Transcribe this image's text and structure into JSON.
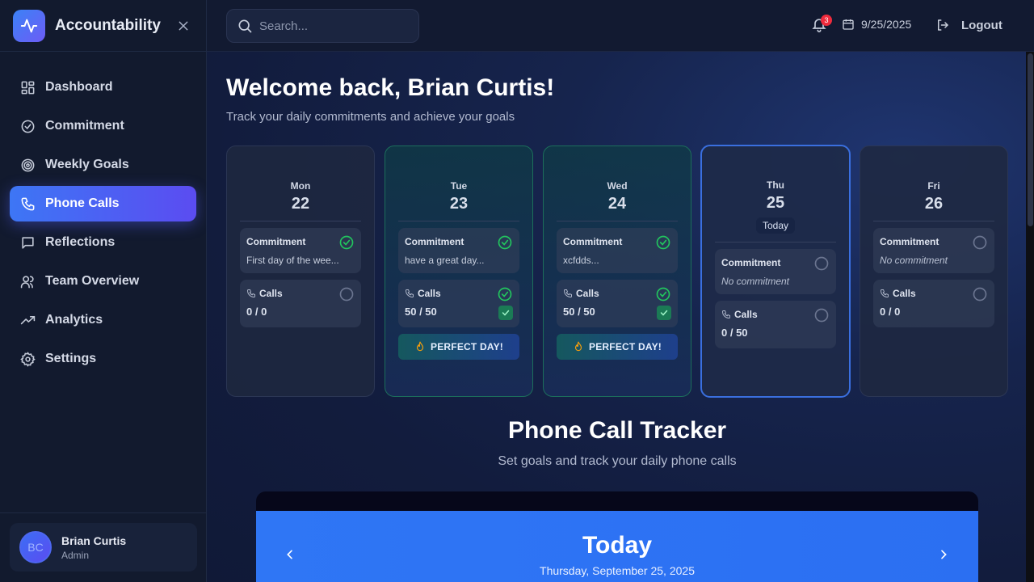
{
  "app": {
    "title": "Accountability"
  },
  "sidebar": {
    "items": [
      {
        "label": "Dashboard",
        "icon": "dashboard-icon"
      },
      {
        "label": "Commitment",
        "icon": "check-circle-icon"
      },
      {
        "label": "Weekly Goals",
        "icon": "target-icon"
      },
      {
        "label": "Phone Calls",
        "icon": "phone-icon",
        "active": true
      },
      {
        "label": "Reflections",
        "icon": "message-square-icon"
      },
      {
        "label": "Team Overview",
        "icon": "users-icon"
      },
      {
        "label": "Analytics",
        "icon": "trending-up-icon"
      },
      {
        "label": "Settings",
        "icon": "gear-icon"
      }
    ],
    "user": {
      "initials": "BC",
      "name": "Brian Curtis",
      "role": "Admin"
    }
  },
  "header": {
    "search_placeholder": "Search...",
    "notifications_count": "3",
    "date": "9/25/2025",
    "logout_label": "Logout"
  },
  "main": {
    "welcome": "Welcome back, Brian Curtis!",
    "subtitle": "Track your daily commitments and achieve your goals",
    "days": [
      {
        "dow": "Mon",
        "dom": "22",
        "commitment_label": "Commitment",
        "commitment_text": "First day of the wee...",
        "commitment_done": true,
        "calls_label": "Calls",
        "calls_value": "0 / 0",
        "calls_done": false
      },
      {
        "dow": "Tue",
        "dom": "23",
        "commitment_label": "Commitment",
        "commitment_text": "have a great day...",
        "commitment_done": true,
        "calls_label": "Calls",
        "calls_value": "50 / 50",
        "calls_done": true,
        "badge": "PERFECT DAY!"
      },
      {
        "dow": "Wed",
        "dom": "24",
        "commitment_label": "Commitment",
        "commitment_text": "xcfdds...",
        "commitment_done": true,
        "calls_label": "Calls",
        "calls_value": "50 / 50",
        "calls_done": true,
        "badge": "PERFECT DAY!"
      },
      {
        "dow": "Thu",
        "dom": "25",
        "today_label": "Today",
        "commitment_label": "Commitment",
        "commitment_text": "No commitment",
        "commitment_done": false,
        "calls_label": "Calls",
        "calls_value": "0 / 50",
        "calls_done": false
      },
      {
        "dow": "Fri",
        "dom": "26",
        "commitment_label": "Commitment",
        "commitment_text": "No commitment",
        "commitment_done": false,
        "calls_label": "Calls",
        "calls_value": "0 / 0",
        "calls_done": false
      }
    ],
    "tracker": {
      "title": "Phone Call Tracker",
      "subtitle": "Set goals and track your daily phone calls",
      "today_label": "Today",
      "date_label": "Thursday, September 25, 2025"
    }
  },
  "colors": {
    "accent": "#3d76f5",
    "accent2": "#5b4cf1",
    "success": "#22c55e",
    "badge": "#ef2b3d"
  }
}
